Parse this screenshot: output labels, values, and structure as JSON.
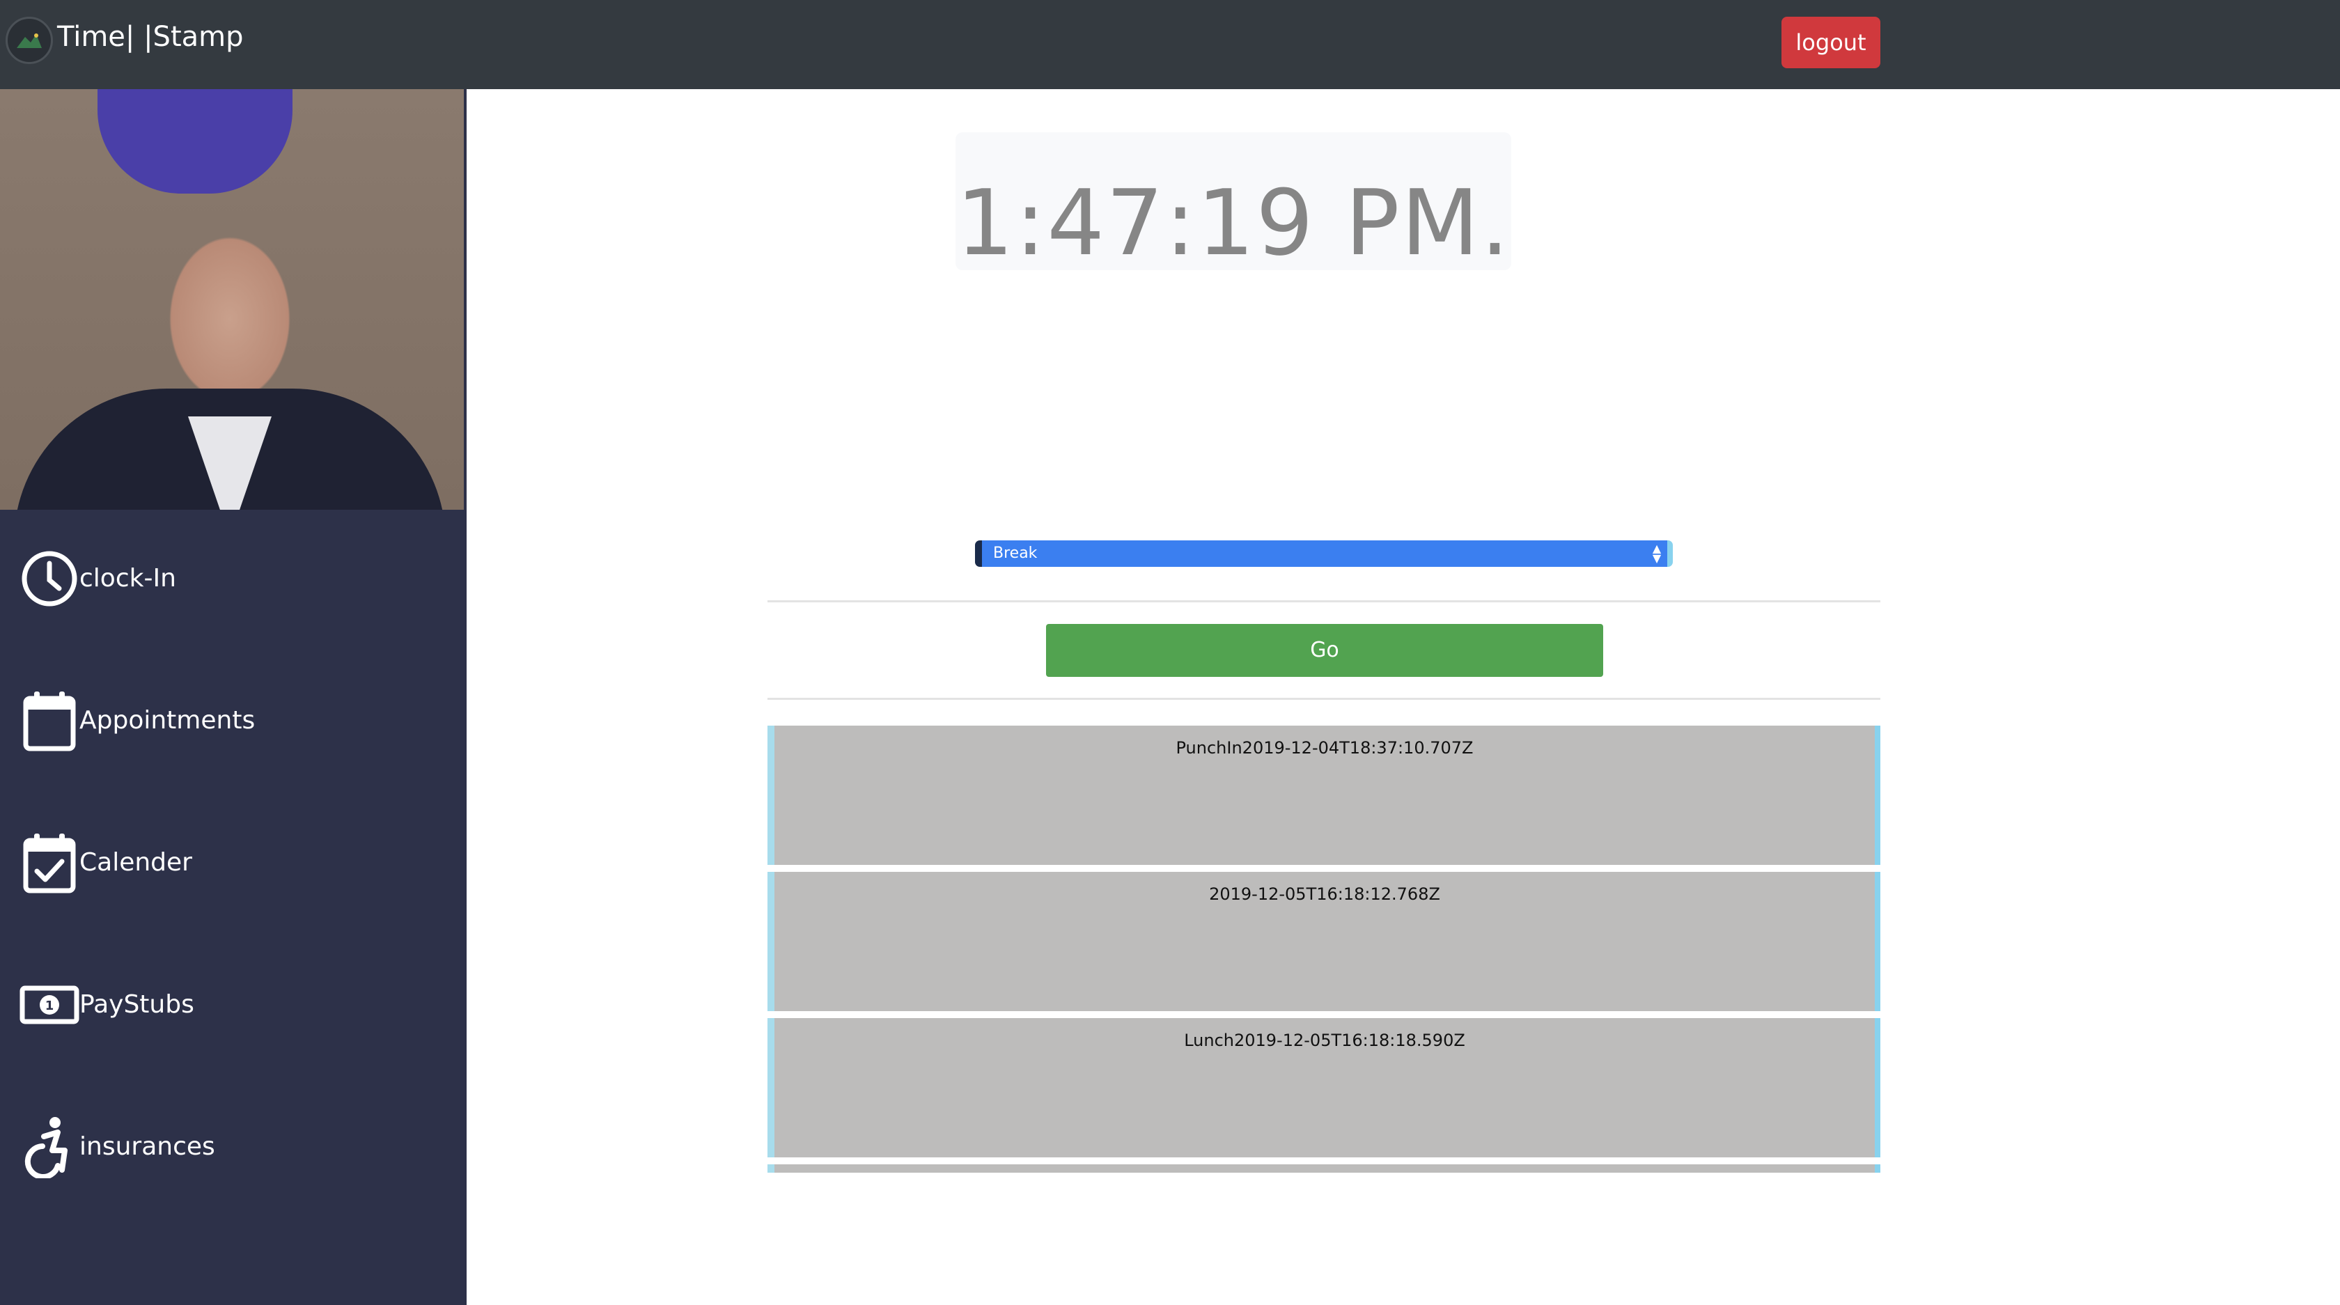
{
  "navbar": {
    "brand": "Time| |Stamp",
    "logout_label": "logout",
    "logout_color": "#d0393d"
  },
  "sidebar": {
    "profile_image": "profile-photo",
    "items": [
      {
        "label": "clock-In",
        "icon": "clock-icon"
      },
      {
        "label": "Appointments",
        "icon": "calendar-icon"
      },
      {
        "label": "Calender",
        "icon": "calendar-check-icon"
      },
      {
        "label": "PayStubs",
        "icon": "money-bill-icon"
      },
      {
        "label": "insurances",
        "icon": "accessibility-icon"
      }
    ]
  },
  "main": {
    "clock": "1:47:19 PM.",
    "punch_select": {
      "value": "Break"
    },
    "go_label": "Go",
    "punches": [
      "PunchIn2019-12-04T18:37:10.707Z",
      "2019-12-05T16:18:12.768Z",
      "Lunch2019-12-05T16:18:18.590Z"
    ]
  },
  "colors": {
    "navbar": "#343a40",
    "sidebar": "#2d3149",
    "go_button": "#52a350",
    "select": "#3b7ff0",
    "punch_card": "#bdbcbb"
  }
}
